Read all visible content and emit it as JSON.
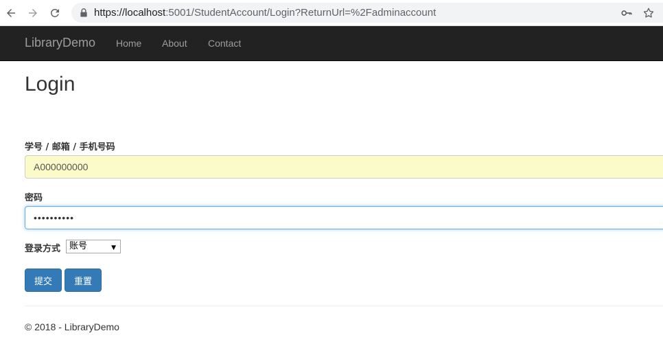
{
  "browser": {
    "url_host": "https://localhost",
    "url_rest": ":5001/StudentAccount/Login?ReturnUrl=%2Fadminaccount"
  },
  "navbar": {
    "brand": "LibraryDemo",
    "links": [
      "Home",
      "About",
      "Contact"
    ]
  },
  "page": {
    "title": "Login",
    "username_label": "学号 / 邮箱 / 手机号码",
    "username_value": "A000000000",
    "password_label": "密码",
    "password_value": "••••••••••",
    "login_mode_label": "登录方式",
    "login_mode_selected": "账号",
    "submit_label": "提交",
    "reset_label": "重置"
  },
  "footer": {
    "text": "© 2018 - LibraryDemo"
  },
  "colors": {
    "navbar_bg": "#222222",
    "nav_text": "#9d9d9d",
    "primary": "#337ab7",
    "autofill_bg": "#fafbc8",
    "focus_border": "#66afe9"
  },
  "icons": [
    "back-arrow-icon",
    "forward-arrow-icon",
    "reload-icon",
    "lock-icon",
    "key-icon",
    "star-icon"
  ]
}
